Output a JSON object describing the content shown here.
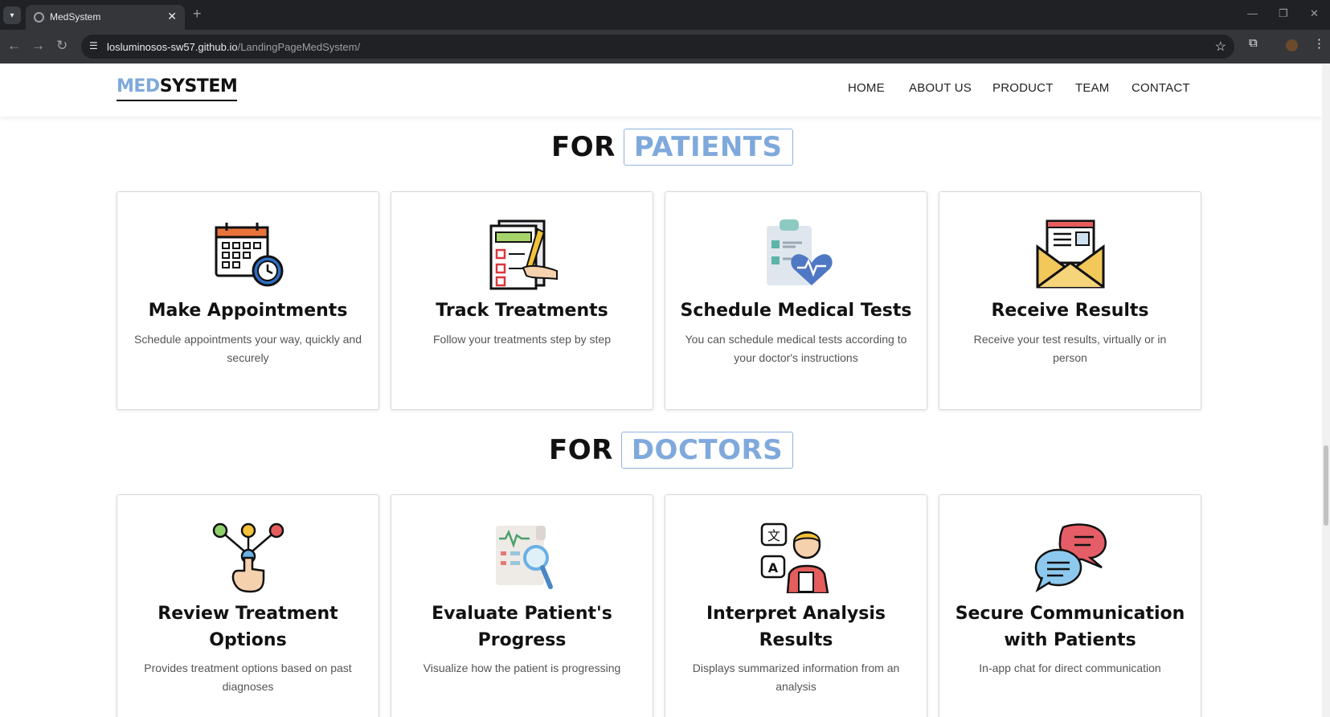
{
  "browser": {
    "tab_title": "MedSystem",
    "url_host": "losluminosos-sw57.github.io",
    "url_path": "/LandingPageMedSystem/"
  },
  "header": {
    "logo_accent": "MED",
    "logo_rest": "SYSTEM",
    "nav": [
      "HOME",
      "ABOUT US",
      "PRODUCT",
      "TEAM",
      "CONTACT"
    ]
  },
  "patients": {
    "title_plain": "FOR",
    "title_boxed": "PATIENTS",
    "cards": [
      {
        "icon": "calendar-clock-icon",
        "title": "Make Appointments",
        "desc": "Schedule appointments your way, quickly and securely"
      },
      {
        "icon": "checklist-pen-icon",
        "title": "Track Treatments",
        "desc": "Follow your treatments step by step"
      },
      {
        "icon": "clipboard-heart-icon",
        "title": "Schedule Medical Tests",
        "desc": "You can schedule medical tests according to your doctor's instructions"
      },
      {
        "icon": "envelope-letter-icon",
        "title": "Receive Results",
        "desc": "Receive your test results, virtually or in person"
      }
    ]
  },
  "doctors": {
    "title_plain": "FOR",
    "title_boxed": "DOCTORS",
    "cards": [
      {
        "icon": "hand-choice-icon",
        "title": "Review Treatment Options",
        "desc": "Provides treatment options based on past diagnoses"
      },
      {
        "icon": "report-magnifier-icon",
        "title": "Evaluate Patient's Progress",
        "desc": "Visualize how the patient is progressing"
      },
      {
        "icon": "doctor-translate-icon",
        "title": "Interpret Analysis Results",
        "desc": "Displays summarized information from an analysis"
      },
      {
        "icon": "chat-bubbles-icon",
        "title": "Secure Communication with Patients",
        "desc": "In-app chat for direct communication"
      }
    ]
  }
}
